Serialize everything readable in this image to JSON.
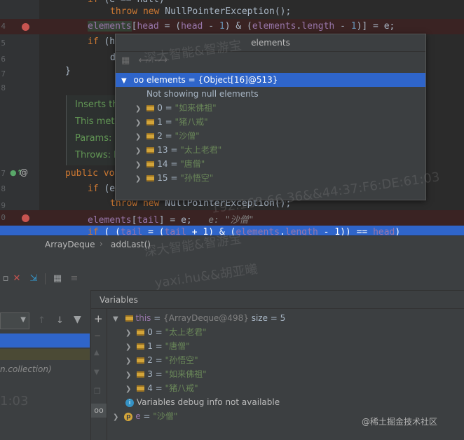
{
  "editor": {
    "lines": [
      {
        "gutter": "",
        "tokens": [
          {
            "t": "if (",
            "c": "kw"
          },
          {
            "t": "...",
            "c": ""
          }
        ]
      },
      {
        "gutter": "",
        "code": "throw new NullPointerException();"
      },
      {
        "gutter": "4",
        "code": "elements[head = (head - 1) & (elements.length - 1)] = e;"
      },
      {
        "gutter": "5",
        "code": "if (h"
      },
      {
        "gutter": "6",
        "code": "d"
      },
      {
        "gutter": "7",
        "code": "}"
      },
      {
        "gutter": "8",
        "code": ""
      },
      {
        "gutter": "",
        "code": "Inserts th"
      },
      {
        "gutter": "",
        "code": "This meth"
      },
      {
        "gutter": "",
        "code": "Params: e"
      },
      {
        "gutter": "",
        "code": "Throws: N"
      },
      {
        "gutter": "7",
        "code": "public vo"
      },
      {
        "gutter": "8",
        "code": "if (e"
      },
      {
        "gutter": "9",
        "code": "throw new NullPointerException();"
      },
      {
        "gutter": "0",
        "code": "elements[tail] = e;   e: \"沙僧\""
      },
      {
        "gutter": "",
        "code": "if ( (tail = (tail + 1) & (elements.length - 1)) == head)"
      }
    ]
  },
  "popup": {
    "title": "elements",
    "root": "elements = {Object[16]@513}",
    "note": "Not showing null elements",
    "items": [
      {
        "index": "0",
        "value": "\"如来佛祖\""
      },
      {
        "index": "1",
        "value": "\"猪八戒\""
      },
      {
        "index": "2",
        "value": "\"沙僧\""
      },
      {
        "index": "13",
        "value": "\"太上老君\""
      },
      {
        "index": "14",
        "value": "\"唐僧\""
      },
      {
        "index": "15",
        "value": "\"孙悟空\""
      }
    ]
  },
  "breadcrumb": {
    "class": "ArrayDeque",
    "method": "addLast()"
  },
  "debug": {
    "variables_title": "Variables",
    "frame_text": "n.collection)",
    "this_row": {
      "name": "this",
      "value": "{ArrayDeque@498}",
      "size": "size = 5"
    },
    "this_items": [
      {
        "index": "0",
        "value": "\"太上老君\""
      },
      {
        "index": "1",
        "value": "\"唐僧\""
      },
      {
        "index": "2",
        "value": "\"孙悟空\""
      },
      {
        "index": "3",
        "value": "\"如来佛祖\""
      },
      {
        "index": "4",
        "value": "\"猪八戒\""
      }
    ],
    "info": "Variables debug info not available",
    "param": {
      "name": "e",
      "value": "\"沙僧\""
    },
    "footer": "@稀土掘金技术社区"
  },
  "watermarks": [
    "深大智能&智游宝",
    "yaxi.hu&&胡亚曦",
    "深大智能&智游宝",
    "192.168.66.36&&44:37:F6:DE:61:03",
    "1:03"
  ],
  "colors": {
    "highlight": "#2f65ca",
    "breakpoint": "#c75450",
    "field": "#9876aa",
    "string": "#6a8759",
    "keyword": "#cc7832"
  }
}
